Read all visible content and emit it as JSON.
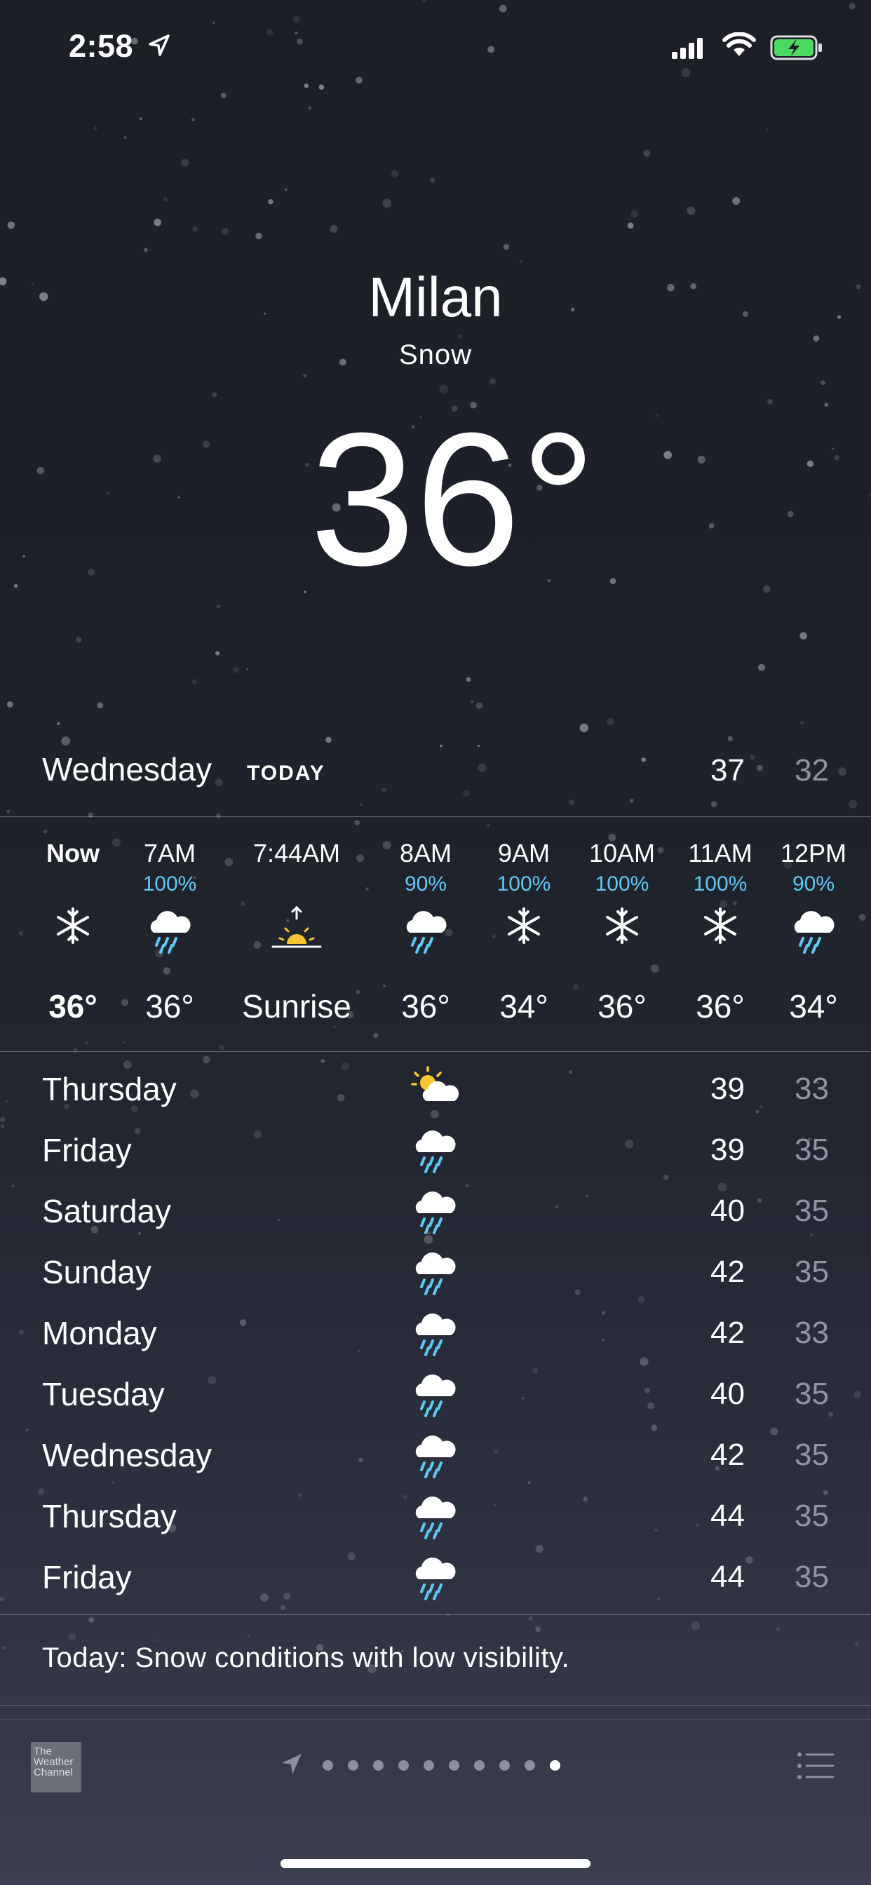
{
  "status_bar": {
    "time": "2:58"
  },
  "header": {
    "city": "Milan",
    "condition": "Snow",
    "temperature": "36°"
  },
  "today": {
    "day": "Wednesday",
    "badge": "TODAY",
    "high": "37",
    "low": "32"
  },
  "hourly": [
    {
      "time": "Now",
      "pop": "",
      "icon": "snowflake-icon",
      "temp": "36°",
      "bold": true
    },
    {
      "time": "7AM",
      "pop": "100%",
      "icon": "rain-cloud-icon",
      "temp": "36°"
    },
    {
      "time": "7:44AM",
      "pop": "",
      "icon": "sunrise-icon",
      "temp": "Sunrise"
    },
    {
      "time": "8AM",
      "pop": "90%",
      "icon": "rain-cloud-icon",
      "temp": "36°"
    },
    {
      "time": "9AM",
      "pop": "100%",
      "icon": "snowflake-icon",
      "temp": "34°"
    },
    {
      "time": "10AM",
      "pop": "100%",
      "icon": "snowflake-icon",
      "temp": "36°"
    },
    {
      "time": "11AM",
      "pop": "100%",
      "icon": "snowflake-icon",
      "temp": "36°"
    },
    {
      "time": "12PM",
      "pop": "90%",
      "icon": "rain-cloud-icon",
      "temp": "34°"
    }
  ],
  "daily": [
    {
      "day": "Thursday",
      "icon": "partly-sunny-icon",
      "high": "39",
      "low": "33"
    },
    {
      "day": "Friday",
      "icon": "rain-cloud-icon",
      "high": "39",
      "low": "35"
    },
    {
      "day": "Saturday",
      "icon": "rain-cloud-icon",
      "high": "40",
      "low": "35"
    },
    {
      "day": "Sunday",
      "icon": "rain-cloud-icon",
      "high": "42",
      "low": "35"
    },
    {
      "day": "Monday",
      "icon": "rain-cloud-icon",
      "high": "42",
      "low": "33"
    },
    {
      "day": "Tuesday",
      "icon": "rain-cloud-icon",
      "high": "40",
      "low": "35"
    },
    {
      "day": "Wednesday",
      "icon": "rain-cloud-icon",
      "high": "42",
      "low": "35"
    },
    {
      "day": "Thursday",
      "icon": "rain-cloud-icon",
      "high": "44",
      "low": "35"
    },
    {
      "day": "Friday",
      "icon": "rain-cloud-icon",
      "high": "44",
      "low": "35"
    }
  ],
  "summary": "Today: Snow conditions with low visibility.",
  "toolbar": {
    "logo_text": "The Weather Channel",
    "page_count": 11,
    "active_page": 11
  },
  "colors": {
    "precip_blue": "#5ec8f5",
    "sun_yellow": "#f7c531",
    "low_temp_gray": "#8f94a0",
    "battery_green": "#4cd964"
  }
}
